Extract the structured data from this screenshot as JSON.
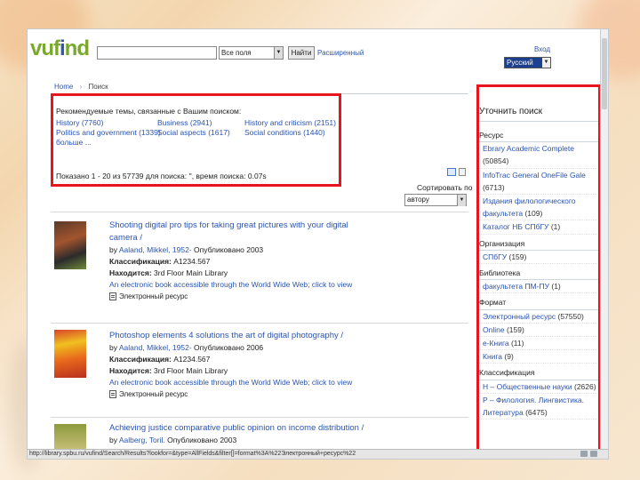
{
  "header": {
    "logo": "vufind",
    "search_scope": "Все поля",
    "search_button": "Найти",
    "advanced_link": "Расширенный",
    "login_link": "Вход",
    "language": "Русский"
  },
  "breadcrumb": {
    "home": "Home",
    "separator": "›",
    "current": "Поиск"
  },
  "recommend": {
    "title": "Рекомендуемые темы, связанные с Вашим поиском:",
    "topics": [
      {
        "label": "History",
        "count": "(7760)"
      },
      {
        "label": "Business",
        "count": "(2941)"
      },
      {
        "label": "History and criticism",
        "count": "(2151)"
      },
      {
        "label": "Politics and government",
        "count": "(1339)"
      },
      {
        "label": "Social aspects",
        "count": "(1617)"
      },
      {
        "label": "Social conditions",
        "count": "(1440)"
      }
    ],
    "more": "больше ..."
  },
  "results_info": "Показано 1 - 20 из 57739 для поиска: '', время поиска: 0.07s",
  "sort": {
    "label": "Сортировать по",
    "value": "автору"
  },
  "records": [
    {
      "title": "Shooting digital pro tips for taking great pictures with your digital camera /",
      "author_prefix": "by",
      "author": "Aaland, Mikkel, 1952-",
      "published": "Опубликовано 2003",
      "class_label": "Классификация:",
      "class_value": "A1234.567",
      "location_label": "Находится:",
      "location_value": "3rd Floor Main Library",
      "link": "An electronic book accessible through the World Wide Web; click to view",
      "eres": "Электронный ресурс"
    },
    {
      "title": "Photoshop elements 4 solutions the art of digital photography /",
      "author_prefix": "by",
      "author": "Aaland, Mikkel, 1952-",
      "published": "Опубликовано 2006",
      "class_label": "Классификация:",
      "class_value": "A1234.567",
      "location_label": "Находится:",
      "location_value": "3rd Floor Main Library",
      "link": "An electronic book accessible through the World Wide Web; click to view",
      "eres": "Электронный ресурс"
    },
    {
      "title": "Achieving justice comparative public opinion on income distribution /",
      "author_prefix": "by",
      "author": "Aalberg, Toril.",
      "published": "Опубликовано 2003"
    }
  ],
  "sidebar": {
    "title": "Уточнить поиск",
    "facets": [
      {
        "heading": "Ресурс",
        "items": [
          {
            "label": "Ebrary Academic Complete",
            "count": "(50854)"
          },
          {
            "label": "InfoTrac General OneFile Gale",
            "count": "(6713)"
          },
          {
            "label": "Издания филологического факультета",
            "count": "(109)"
          },
          {
            "label": "Каталог НБ СПбГУ",
            "count": "(1)"
          }
        ]
      },
      {
        "heading": "Организация",
        "items": [
          {
            "label": "СПбГУ",
            "count": "(159)"
          }
        ]
      },
      {
        "heading": "Библиотека",
        "items": [
          {
            "label": "факультета ПМ-ПУ",
            "count": "(1)"
          }
        ]
      },
      {
        "heading": "Формат",
        "items": [
          {
            "label": "Электронный ресурс",
            "count": "(57550)"
          },
          {
            "label": "Online",
            "count": "(159)"
          },
          {
            "label": "e-Книга",
            "count": "(11)"
          },
          {
            "label": "Книга",
            "count": "(9)"
          }
        ]
      },
      {
        "heading": "Классификация",
        "items": [
          {
            "label": "H – Общественные науки",
            "count": "(2626)"
          },
          {
            "label": "P – Филология. Лингвистика. Литература",
            "count": "(6475)"
          }
        ]
      }
    ]
  },
  "statusbar": "http://library.spbu.ru/vufind/Search/Results?lookfor=&type=AllFields&filter[]=format%3A%22Электронный+ресурс%22"
}
